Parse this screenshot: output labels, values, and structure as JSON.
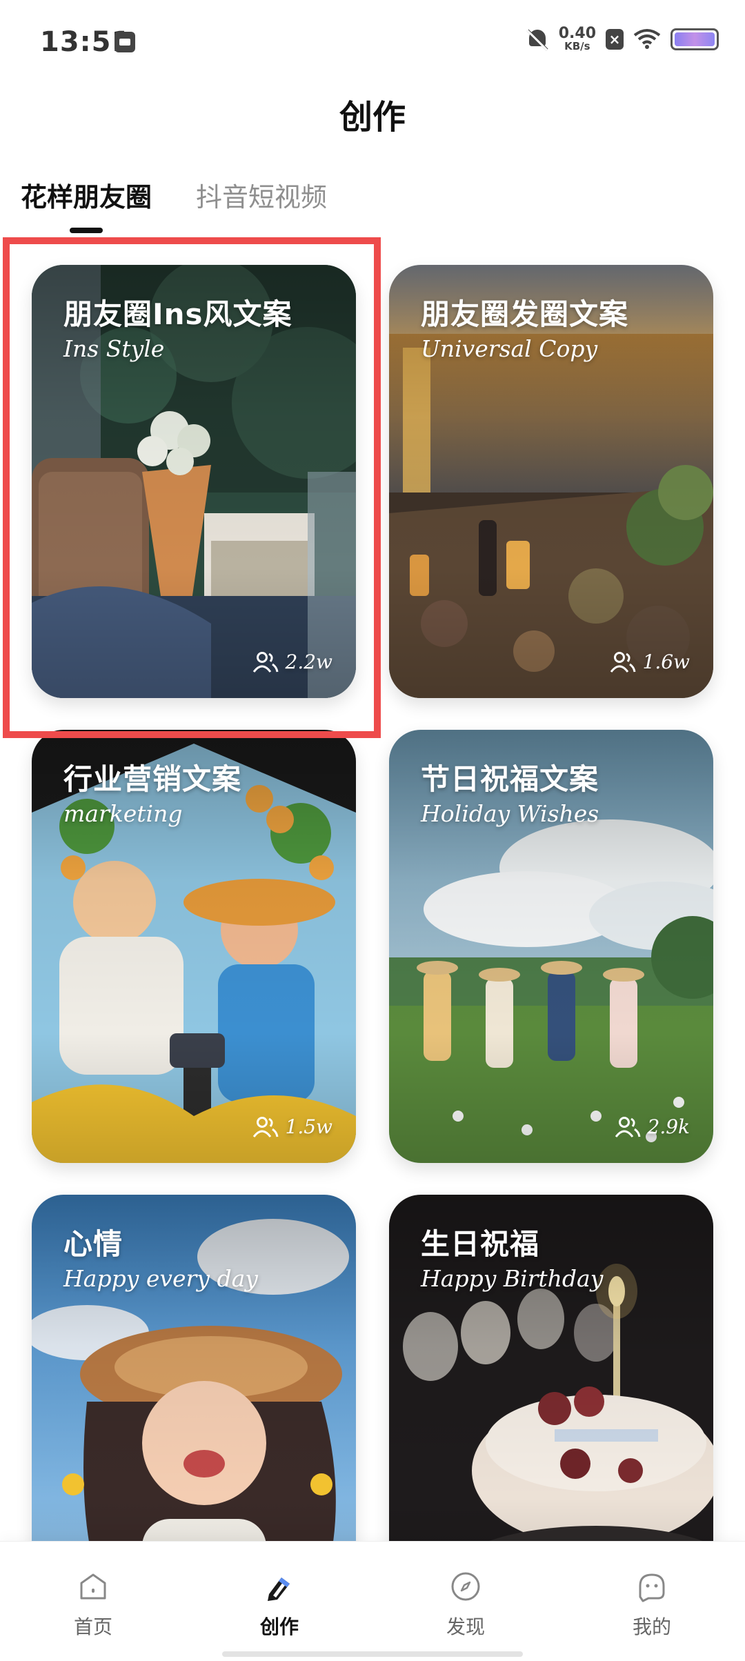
{
  "status_bar": {
    "time": "13:51",
    "net_speed_value": "0.40",
    "net_speed_unit": "KB/s",
    "x_badge": "×",
    "icons": [
      "calendar-icon",
      "mute-icon",
      "close-badge-icon",
      "wifi-icon",
      "battery-icon"
    ]
  },
  "header": {
    "title": "创作"
  },
  "tabs": [
    {
      "label": "花样朋友圈",
      "active": true
    },
    {
      "label": "抖音短视频",
      "active": false
    }
  ],
  "cards": [
    {
      "title": "朋友圈Ins风文案",
      "subtitle": "Ins Style",
      "count": "2.2w",
      "highlighted": true
    },
    {
      "title": "朋友圈发圈文案",
      "subtitle": "Universal Copy",
      "count": "1.6w"
    },
    {
      "title": "行业营销文案",
      "subtitle": "marketing",
      "count": "1.5w"
    },
    {
      "title": "节日祝福文案",
      "subtitle": "Holiday Wishes",
      "count": "2.9k"
    },
    {
      "title": "心情",
      "subtitle": "Happy every day"
    },
    {
      "title": "生日祝福",
      "subtitle": "Happy Birthday"
    }
  ],
  "bottom_nav": [
    {
      "label": "首页",
      "icon": "home-icon",
      "active": false
    },
    {
      "label": "创作",
      "icon": "pen-icon",
      "active": true
    },
    {
      "label": "发现",
      "icon": "compass-icon",
      "active": false
    },
    {
      "label": "我的",
      "icon": "profile-icon",
      "active": false
    }
  ],
  "colors": {
    "highlight_border": "#ee4b4b",
    "text_primary": "#111111",
    "tab_inactive": "#8f8f8f"
  }
}
